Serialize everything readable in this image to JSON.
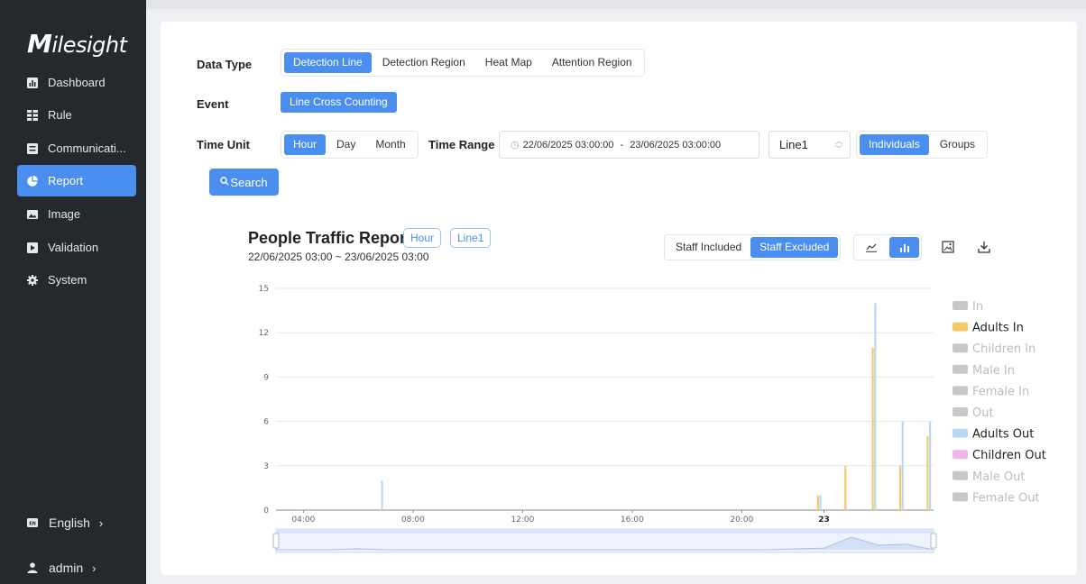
{
  "brand": "Milesight",
  "sidebar": {
    "items": [
      {
        "label": "Dashboard",
        "icon": "bar-chart-icon"
      },
      {
        "label": "Rule",
        "icon": "rule-icon"
      },
      {
        "label": "Communicati...",
        "icon": "communication-icon"
      },
      {
        "label": "Report",
        "icon": "pie-chart-icon",
        "active": true
      },
      {
        "label": "Image",
        "icon": "image-icon"
      },
      {
        "label": "Validation",
        "icon": "validation-icon"
      },
      {
        "label": "System",
        "icon": "gear-icon"
      }
    ],
    "language": "English",
    "user": "admin",
    "chevron": "›"
  },
  "form": {
    "data_type": {
      "label": "Data Type",
      "options": [
        "Detection Line",
        "Detection Region",
        "Heat Map",
        "Attention Region"
      ],
      "selected": "Detection Line"
    },
    "event": {
      "label": "Event",
      "options": [
        "Line Cross Counting"
      ],
      "selected": "Line Cross Counting"
    },
    "time_unit": {
      "label": "Time Unit",
      "options": [
        "Hour",
        "Day",
        "Month"
      ],
      "selected": "Hour"
    },
    "time_range": {
      "label": "Time Range",
      "start": "22/06/2025 03:00:00",
      "separator": "-",
      "end": "23/06/2025 03:00:00"
    },
    "line_select": "Line1",
    "group_mode": {
      "options": [
        "Individuals",
        "Groups"
      ],
      "selected": "Individuals"
    },
    "search_label": "Search"
  },
  "report": {
    "title": "People Traffic Report",
    "tags": [
      "Hour",
      "Line1"
    ],
    "range": "22/06/2025 03:00 ~ 23/06/2025 03:00",
    "staff": {
      "options": [
        "Staff Included",
        "Staff Excluded"
      ],
      "selected": "Staff Excluded"
    },
    "chart_modes": [
      "line-chart-icon",
      "bar-chart-icon"
    ],
    "selected_mode": "bar-chart-icon",
    "tools": [
      "save-image-icon",
      "download-icon"
    ]
  },
  "colors": {
    "accent": "#4a8ff0",
    "sidebar_bg": "#25282d",
    "adults_in": "#f5c96a",
    "adults_out": "#b9d8f5",
    "children_out": "#f0b6e6",
    "disabled": "#c8c8c8"
  },
  "chart_data": {
    "type": "bar",
    "ylim": [
      0,
      15
    ],
    "yticks": [
      0,
      3,
      6,
      9,
      12,
      15
    ],
    "xticks": [
      {
        "label": "04:00",
        "bold": false
      },
      {
        "label": "08:00",
        "bold": false
      },
      {
        "label": "12:00",
        "bold": false
      },
      {
        "label": "16:00",
        "bold": false
      },
      {
        "label": "20:00",
        "bold": false
      },
      {
        "label": "23",
        "bold": true
      }
    ],
    "x_range_hours": [
      3,
      27
    ],
    "categories_hours": [
      6,
      22,
      23,
      24,
      25,
      26
    ],
    "legend": [
      {
        "name": "In",
        "active": false,
        "color": "#c8c8c8"
      },
      {
        "name": "Adults In",
        "active": true,
        "color": "#f5c96a"
      },
      {
        "name": "Children In",
        "active": false,
        "color": "#c8c8c8"
      },
      {
        "name": "Male In",
        "active": false,
        "color": "#c8c8c8"
      },
      {
        "name": "Female In",
        "active": false,
        "color": "#c8c8c8"
      },
      {
        "name": "Out",
        "active": false,
        "color": "#c8c8c8"
      },
      {
        "name": "Adults Out",
        "active": true,
        "color": "#b9d8f5"
      },
      {
        "name": "Children Out",
        "active": true,
        "color": "#f0b6e6"
      },
      {
        "name": "Male Out",
        "active": false,
        "color": "#c8c8c8"
      },
      {
        "name": "Female Out",
        "active": false,
        "color": "#c8c8c8"
      }
    ],
    "series": [
      {
        "name": "Adults In",
        "color": "#f5c96a",
        "values": [
          0,
          1,
          3,
          11,
          3,
          5
        ]
      },
      {
        "name": "Adults Out",
        "color": "#b9d8f5",
        "values": [
          2,
          1,
          0,
          14,
          6,
          6
        ]
      },
      {
        "name": "Children Out",
        "color": "#f0b6e6",
        "values": [
          0,
          0,
          0,
          0,
          0,
          0
        ]
      }
    ],
    "grid": true
  }
}
